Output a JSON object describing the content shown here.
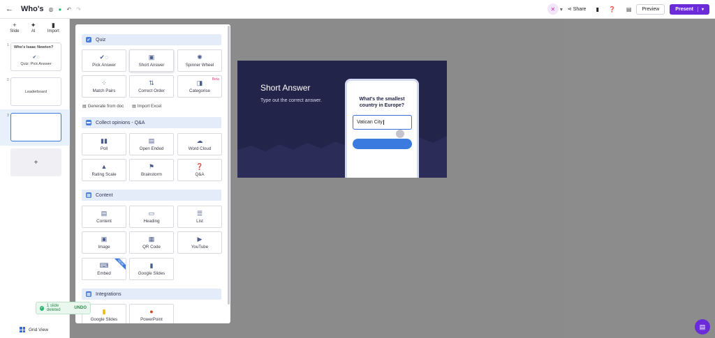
{
  "topbar": {
    "back_icon": "arrow-left-icon",
    "title": "Who's",
    "share_label": "Share",
    "preview_label": "Preview",
    "present_label": "Present"
  },
  "leftrail": {
    "tools": [
      {
        "label": "Slide",
        "glyph": "+"
      },
      {
        "label": "AI",
        "glyph": "✦"
      },
      {
        "label": "Import",
        "glyph": "▮"
      }
    ],
    "slides": [
      {
        "num": "1",
        "title": "Who's Isaac Newton?",
        "subtitle": "Quiz: Pick Answer"
      },
      {
        "num": "2",
        "title": "Leaderboard",
        "subtitle": ""
      },
      {
        "num": "3",
        "title": "",
        "subtitle": ""
      }
    ],
    "add_glyph": "+",
    "grid_view_label": "Grid View"
  },
  "panel": {
    "sections": {
      "quiz": "Quiz",
      "opinions": "Collect opinions - Q&A",
      "content": "Content",
      "integrations": "Integrations"
    },
    "quiz_tiles": [
      "Pick Answer",
      "Short Answer",
      "Spinner Wheel",
      "Match Pairs",
      "Correct Order",
      "Categorise"
    ],
    "beta_label": "Beta",
    "generate_label": "Generate from doc",
    "import_excel_label": "Import Excel",
    "opinion_tiles": [
      "Poll",
      "Open Ended",
      "Word Cloud",
      "Rating Scale",
      "Brainstorm",
      "Q&A"
    ],
    "content_tiles": [
      "Content",
      "Heading",
      "List",
      "Image",
      "QR Code",
      "YouTube",
      "Embed",
      "Google Slides"
    ],
    "new_label": "NEW",
    "integration_tiles": [
      "Google Slides",
      "PowerPoint"
    ]
  },
  "preview": {
    "title": "Short Answer",
    "subtitle": "Type out the correct answer.",
    "question": "What's the smallest country in Europe?",
    "answer_value": "Vatican City"
  },
  "toast": {
    "message": "1 slide deleted",
    "undo_label": "UNDO"
  },
  "colors": {
    "accent": "#6b2bd9",
    "primary_blue": "#3b7be0",
    "slide_bg": "#232449",
    "success": "#2bb673"
  }
}
